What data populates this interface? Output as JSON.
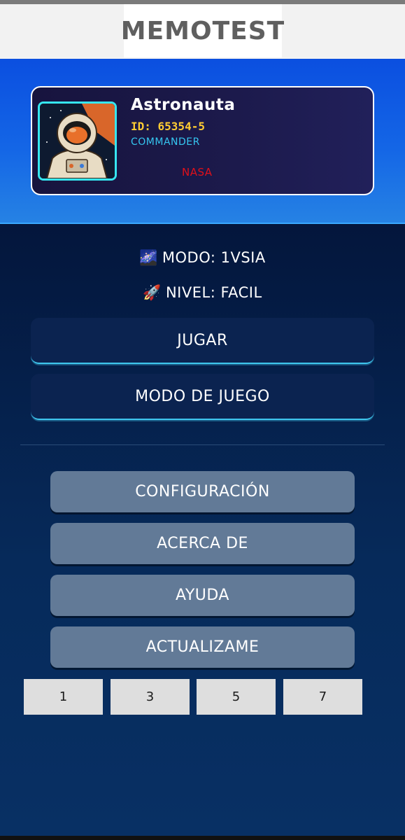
{
  "header": {
    "title": "MEMOTEST"
  },
  "player": {
    "avatar_icon": "astronaut-avatar-icon",
    "name": "Astronauta",
    "id": "ID: 65354-5",
    "rank": "COMMANDER",
    "org": "NASA"
  },
  "status": {
    "mode_icon": "🌌",
    "mode": "MODO: 1VSIA",
    "level_icon": "🚀",
    "level": "NIVEL: FACIL"
  },
  "actions": {
    "play": "JUGAR",
    "game_mode": "MODO DE JUEGO"
  },
  "menu": {
    "settings": "CONFIGURACIÓN",
    "about": "ACERCA DE",
    "help": "AYUDA",
    "update": "ACTUALIZAME"
  },
  "number_buttons": [
    "1",
    "3",
    "5",
    "7"
  ],
  "colors": {
    "hero_gradient_top": "#0b4fe0",
    "card_bg": "#1c1a4c",
    "id_color": "#ffcc33",
    "rank_color": "#35c6f0",
    "org_color": "#e0101a",
    "menu_button": "#627a97",
    "primary_button": "#0b2350",
    "accent": "#3fc6ee"
  }
}
